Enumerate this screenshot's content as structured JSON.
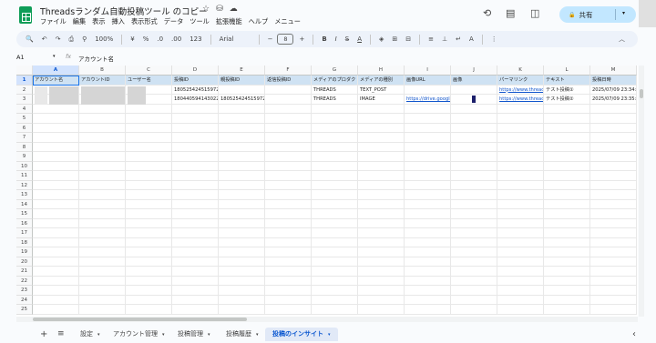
{
  "doc": {
    "title": "Threadsランダム自動投稿ツール のコピー",
    "title_icons": [
      "☆",
      "⛁",
      "☁"
    ]
  },
  "menu": [
    "ファイル",
    "編集",
    "表示",
    "挿入",
    "表示形式",
    "データ",
    "ツール",
    "拡張機能",
    "ヘルプ",
    "メニュー"
  ],
  "header_right": {
    "history_icon": "⟲",
    "comment_icon": "▤",
    "meet_icon": "◫",
    "share_label": "共有",
    "share_chevron": "▾",
    "lock_icon": "🔒"
  },
  "toolbar": {
    "search": "🔍",
    "undo": "↶",
    "redo": "↷",
    "print": "⎙",
    "paint": "⚲",
    "zoom": "100%",
    "currency": "¥",
    "percent": "%",
    "dec_dec": ".0",
    "dec_inc": ".00",
    "num_fmt": "123",
    "font": "Arial",
    "minus": "−",
    "font_size": "8",
    "plus": "+",
    "bold": "B",
    "italic": "I",
    "strike": "S̶",
    "text_color": "A",
    "fill": "◈",
    "borders": "⊞",
    "merge": "⊟",
    "align": "≡",
    "valign": "⊥",
    "wrap": "↵",
    "rotate": "A",
    "more": "⋮",
    "collapse": "︿"
  },
  "formula_bar": {
    "cell_ref": "A1",
    "fx": "fx",
    "value": "アカウント名"
  },
  "columns": [
    "A",
    "B",
    "C",
    "D",
    "E",
    "F",
    "G",
    "H",
    "I",
    "J",
    "K",
    "L",
    "M"
  ],
  "rows": [
    "1",
    "2",
    "3",
    "4",
    "5",
    "6",
    "7",
    "8",
    "9",
    "10",
    "11",
    "12",
    "13",
    "14",
    "15",
    "16",
    "17",
    "18",
    "19",
    "20",
    "21",
    "22",
    "23",
    "24",
    "25"
  ],
  "headers": [
    "アカウント名",
    "アカウントID",
    "ユーザー名",
    "投稿ID",
    "親投稿ID",
    "返信投稿ID",
    "メディアのプロダクト",
    "メディアの種別",
    "画像URL",
    "画像",
    "パーマリンク",
    "テキスト",
    "投稿日時"
  ],
  "data_rows": [
    {
      "D": "18052542451597244",
      "E": "",
      "G": "THREADS",
      "H": "TEXT_POST",
      "I": "",
      "K": "https://www.threads.ne",
      "L": "テスト投稿①",
      "M": "2025/07/09 23:34:34"
    },
    {
      "D": "18044059414302251",
      "E": "18052542451597244",
      "G": "THREADS",
      "H": "IMAGE",
      "I": "https://drive.google.co",
      "K": "https://www.threads.ne",
      "L": "テスト投稿②",
      "M": "2025/07/09 23:35:09"
    }
  ],
  "sheets": {
    "add": "+",
    "list": "≡",
    "tabs": [
      {
        "label": "設定",
        "active": false
      },
      {
        "label": "アカウント管理",
        "active": false
      },
      {
        "label": "投稿管理",
        "active": false
      },
      {
        "label": "投稿履歴",
        "active": false
      },
      {
        "label": "投稿のインサイト",
        "active": true
      }
    ],
    "tab_arrow": "▾",
    "scroll_left": "‹"
  }
}
